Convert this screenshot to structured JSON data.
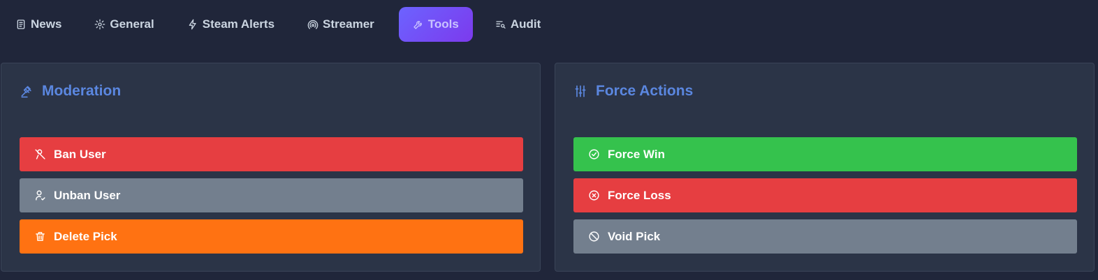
{
  "nav": {
    "tabs": [
      {
        "label": "News",
        "icon": "newspaper-icon"
      },
      {
        "label": "General",
        "icon": "gear-icon"
      },
      {
        "label": "Steam Alerts",
        "icon": "lightning-icon"
      },
      {
        "label": "Streamer",
        "icon": "broadcast-icon"
      },
      {
        "label": "Tools",
        "icon": "wrench-icon",
        "active": true
      },
      {
        "label": "Audit",
        "icon": "list-search-icon"
      }
    ]
  },
  "moderation": {
    "title": "Moderation",
    "icon": "gavel-icon",
    "buttons": [
      {
        "label": "Ban User",
        "icon": "user-ban-icon",
        "color": "#e63e41"
      },
      {
        "label": "Unban User",
        "icon": "user-check-icon",
        "color": "#737f8e"
      },
      {
        "label": "Delete Pick",
        "icon": "trash-icon",
        "color": "#ff7212"
      }
    ]
  },
  "force_actions": {
    "title": "Force Actions",
    "icon": "sliders-icon",
    "buttons": [
      {
        "label": "Force Win",
        "icon": "check-circle-icon",
        "color": "#35c24d"
      },
      {
        "label": "Force Loss",
        "icon": "x-circle-icon",
        "color": "#e63e41"
      },
      {
        "label": "Void Pick",
        "icon": "ban-icon",
        "color": "#737f8e"
      }
    ]
  },
  "colors": {
    "background": "#20263a",
    "panel": "#2b3447",
    "title_accent": "#5b87e0",
    "active_tab": "#6c63ff"
  }
}
